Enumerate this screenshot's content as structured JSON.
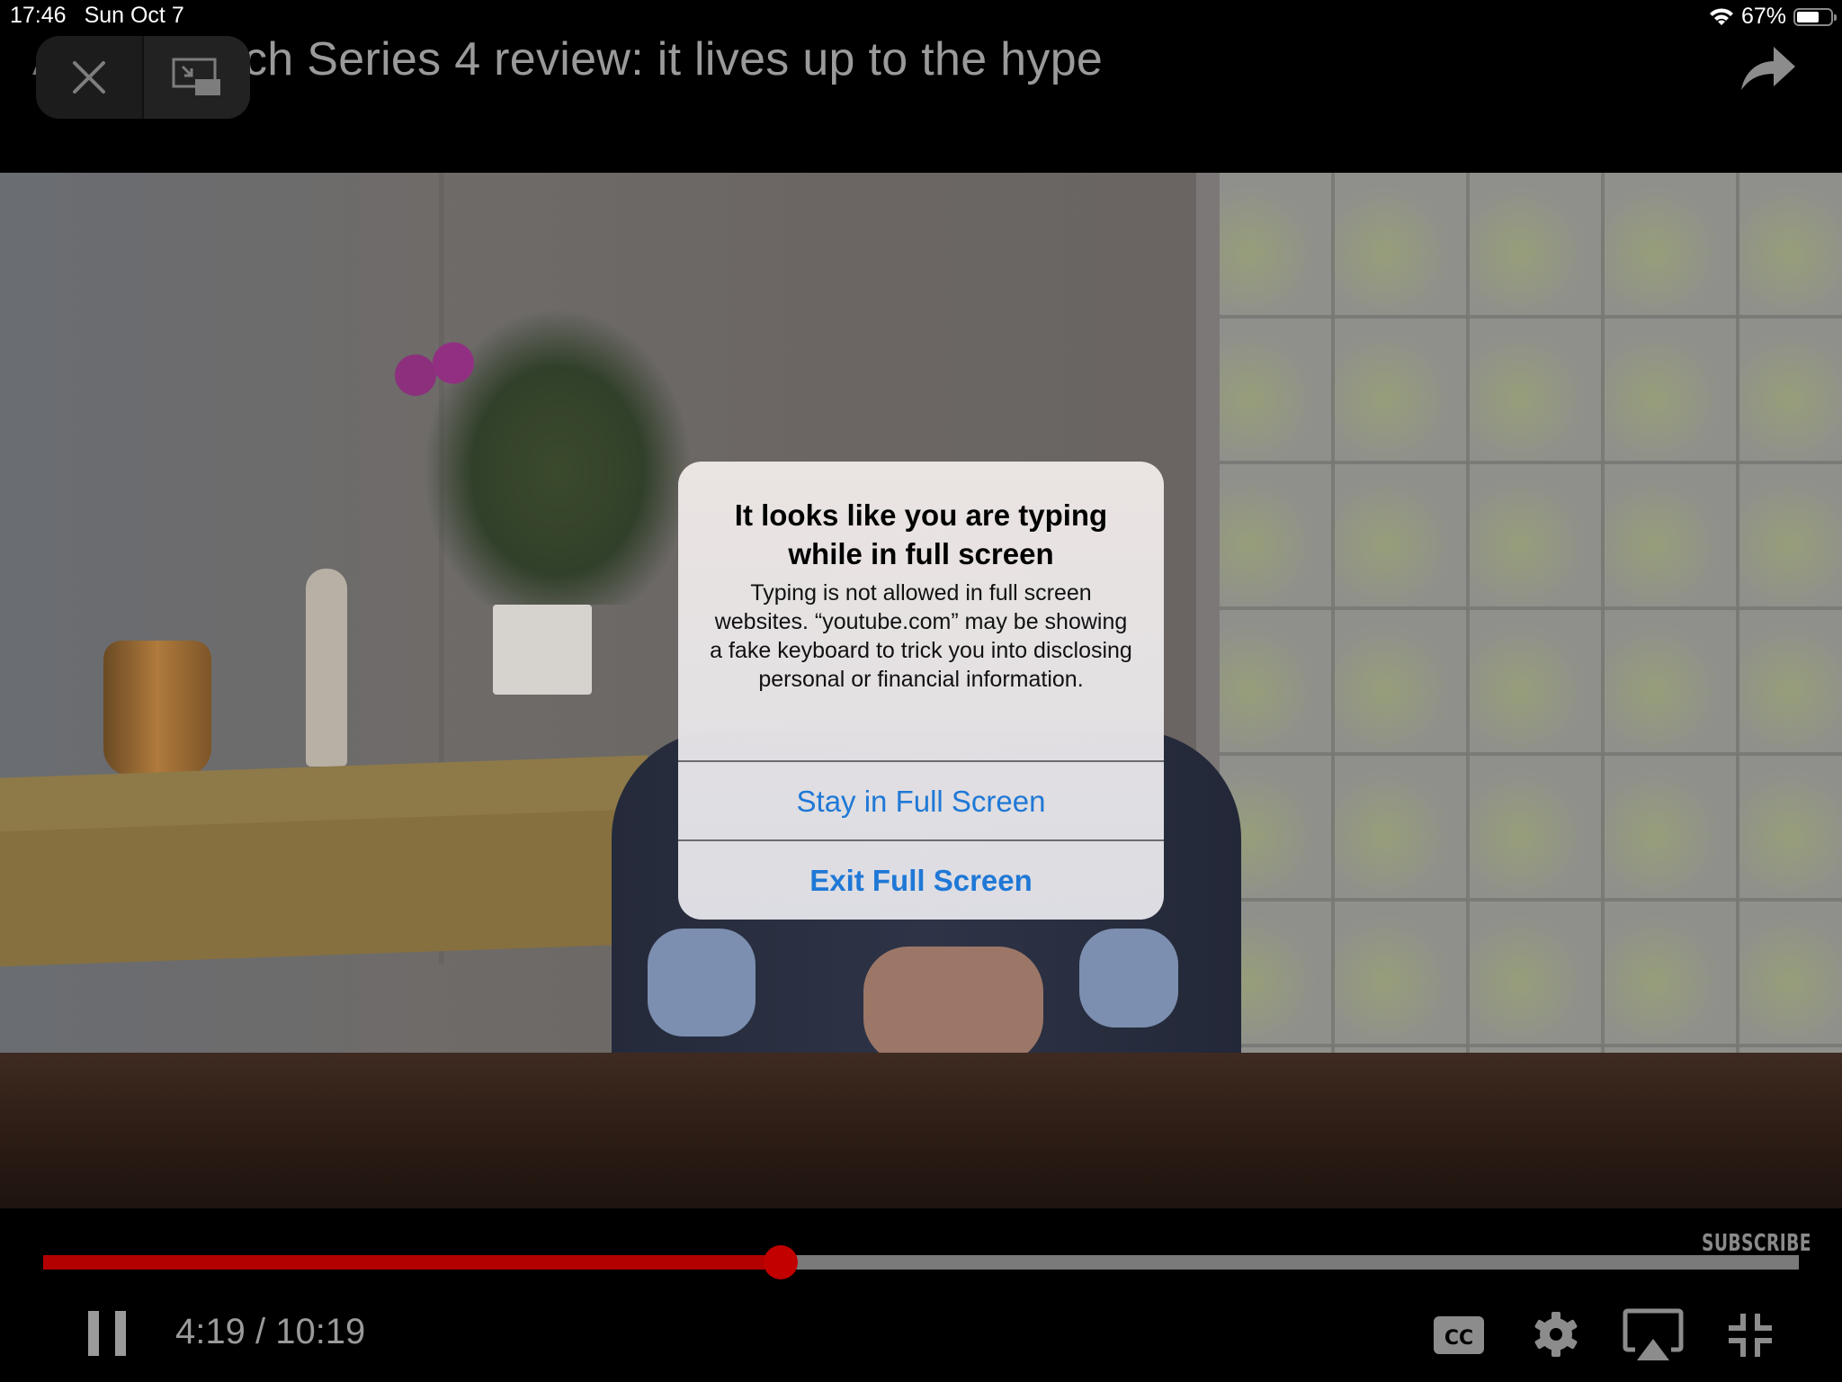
{
  "status_bar": {
    "time": "17:46",
    "date": "Sun Oct 7",
    "wifi_icon": "wifi-icon",
    "battery_percent": "67%",
    "battery_level": 0.67
  },
  "header": {
    "video_title": "Apple Watch Series 4 review: it lives up to the hype",
    "video_title_visible": "ch Series 4 review: it lives up to the hype",
    "close_icon": "close-icon",
    "pip_icon": "picture-in-picture-icon",
    "share_icon": "share-arrow-icon"
  },
  "dialog": {
    "title": "It looks like you are typing while in full screen",
    "message": "Typing is not allowed in full screen websites. “youtube.com” may be showing a fake keyboard to trick you into disclosing personal or financial information.",
    "actions": [
      {
        "label": "Stay in Full Screen",
        "style": "default"
      },
      {
        "label": "Exit Full Screen",
        "style": "bold"
      }
    ],
    "action_color": "#1f78d6"
  },
  "player": {
    "subscribe_label": "SUBSCRIBE",
    "current_time": "4:19",
    "duration": "10:19",
    "time_display": "4:19 / 10:19",
    "progress_fraction": 0.42,
    "progress_color": "#b30000",
    "controls": [
      {
        "name": "pause-icon"
      },
      {
        "name": "closed-captions-icon",
        "label": "CC"
      },
      {
        "name": "settings-gear-icon"
      },
      {
        "name": "airplay-icon"
      },
      {
        "name": "exit-fullscreen-icon"
      }
    ]
  }
}
